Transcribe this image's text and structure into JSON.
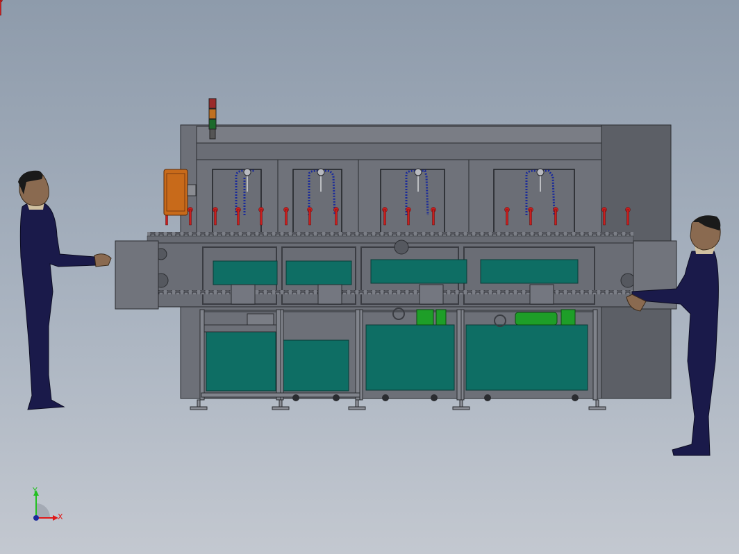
{
  "triad": {
    "y_label": "Y",
    "x_label": "X",
    "y_color": "#22c020",
    "x_color": "#e01818",
    "z_color": "#1c2a9a"
  },
  "colors": {
    "frame": "#6d7078",
    "frame_light": "#80838b",
    "frame_dark": "#54575e",
    "tank": "#0e6e64",
    "pump": "#1e9e28",
    "motor": "#c86a1a",
    "nozzle": "#c81e1e",
    "hose": "#1a2a9a",
    "worker_suit": "#1a1a4a",
    "worker_skin": "#8a6a50"
  },
  "scene": {
    "stations": 4,
    "signal_tower": [
      "red",
      "orange",
      "green"
    ]
  }
}
